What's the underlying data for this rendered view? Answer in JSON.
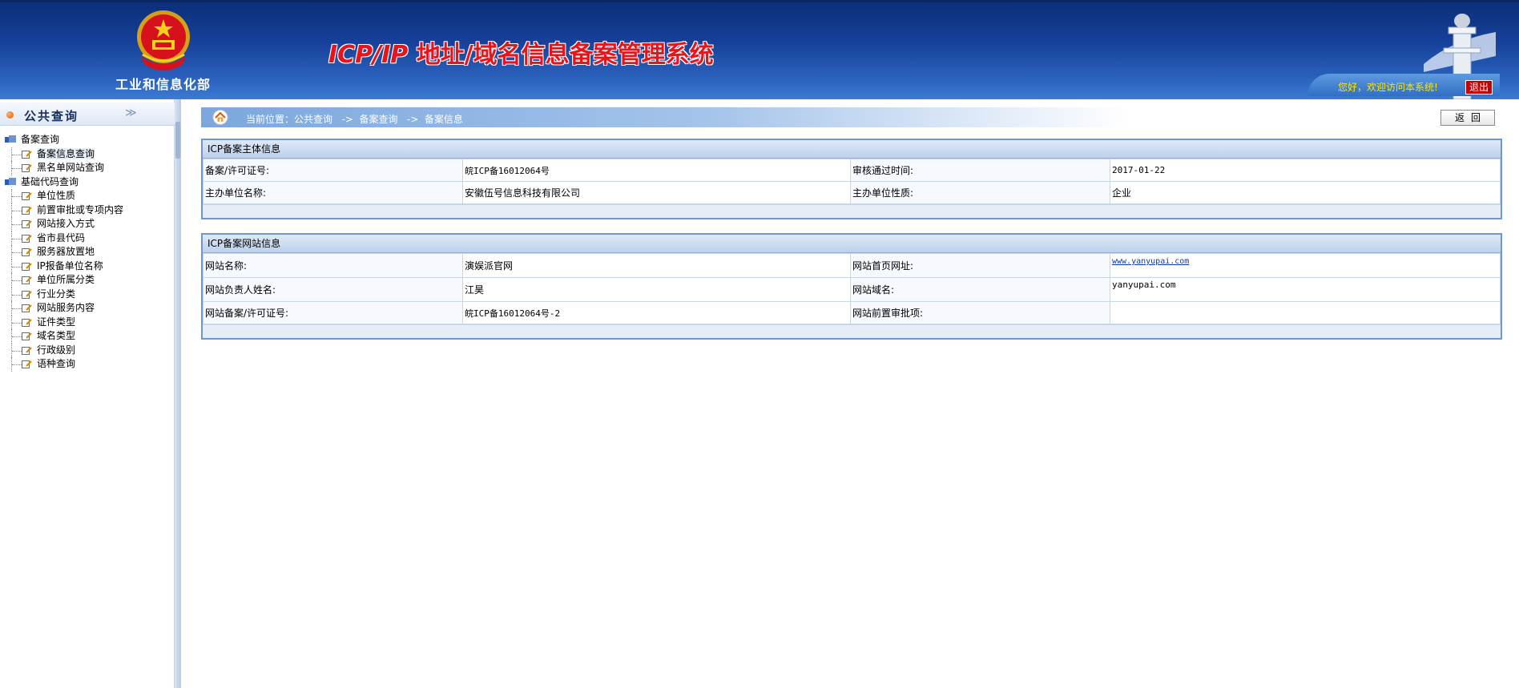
{
  "header": {
    "ministry_name": "工业和信息化部",
    "system_title_latin": "ICP/IP",
    "system_title_cjk": " 地址/域名信息备案管理系统",
    "welcome_text": "您好，欢迎访问本系统!",
    "logout_label": "退出",
    "colors": {
      "header_top": "#0b2f7a",
      "header_bottom": "#3e7fd2",
      "title_red": "#e8141b",
      "welcome_yellow": "#ffe400"
    }
  },
  "sidebar": {
    "title": "公共查询",
    "collapse_glyph": "≫",
    "groups": [
      {
        "label": "备案查询",
        "items": [
          "备案信息查询",
          "黑名单网站查询"
        ]
      },
      {
        "label": "基础代码查询",
        "items": [
          "单位性质",
          "前置审批或专项内容",
          "网站接入方式",
          "省市县代码",
          "服务器放置地",
          "IP报备单位名称",
          "单位所属分类",
          "行业分类",
          "网站服务内容",
          "证件类型",
          "域名类型",
          "行政级别",
          "语种查询"
        ]
      }
    ]
  },
  "breadcrumb": {
    "text": "当前位置：公共查询   ->  备案查询   ->  备案信息"
  },
  "back_label": "返回",
  "subject_panel": {
    "title": "ICP备案主体信息",
    "rows": [
      {
        "label1": "备案/许可证号:",
        "value1": "皖ICP备16012064号",
        "label2": "审核通过时间:",
        "value2": "2017-01-22"
      },
      {
        "label1": "主办单位名称:",
        "value1": "安徽伍号信息科技有限公司",
        "label2": "主办单位性质:",
        "value2": "企业"
      }
    ]
  },
  "website_panel": {
    "title": "ICP备案网站信息",
    "rows": [
      {
        "label1": "网站名称:",
        "value1": "演娱派官网",
        "label2": "网站首页网址:",
        "value2": "www.yanyupai.com"
      },
      {
        "label1": "网站负责人姓名:",
        "value1": "江昊",
        "label2": "网站域名:",
        "value2": "yanyupai.com"
      },
      {
        "label1": "网站备案/许可证号:",
        "value1": "皖ICP备16012064号-2",
        "label2": "网站前置审批项:",
        "value2": ""
      }
    ]
  }
}
